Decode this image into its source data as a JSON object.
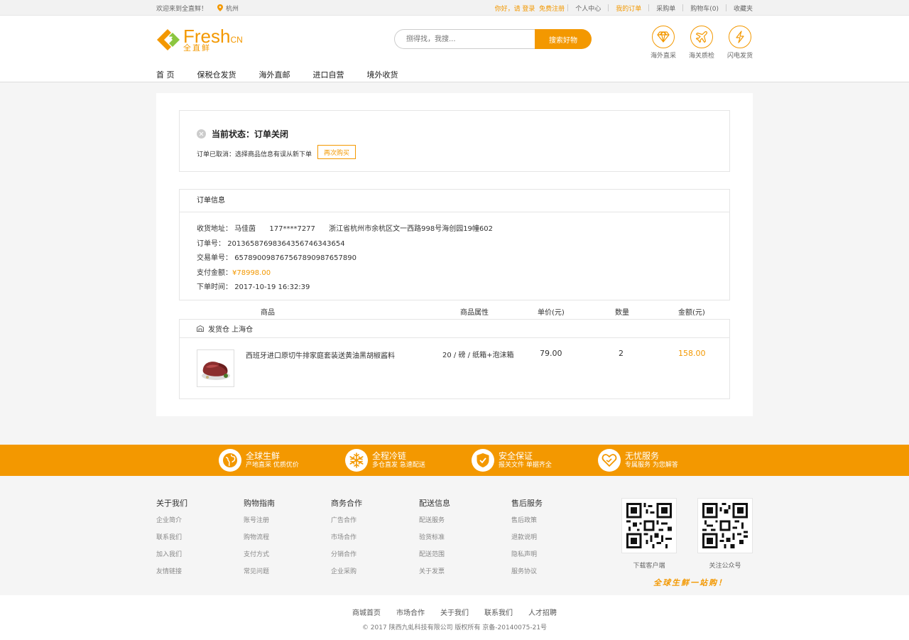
{
  "topbar": {
    "welcome": "欢迎来到全直鲜！",
    "city": "杭州",
    "greeting": "你好，请 登录",
    "register": "免费注册",
    "links": [
      "个人中心",
      "我的订单",
      "采购单",
      "购物车(0)",
      "收藏夹"
    ]
  },
  "header": {
    "logo_en": "Fresh",
    "logo_cn_suffix": "CN",
    "logo_cn": "全直鲜",
    "search_placeholder": "捌得找，我搜...",
    "search_button": "搜索好物",
    "services": [
      "海外直采",
      "海关质检",
      "闪电发货"
    ]
  },
  "nav": [
    "首 页",
    "保税仓发货",
    "海外直邮",
    "进口自营",
    "境外收货"
  ],
  "status": {
    "title": "当前状态：订单关闭",
    "desc": "订单已取消：选择商品信息有误从新下单",
    "rebuy": "再次购买"
  },
  "order_info": {
    "heading": "订单信息",
    "address_label": "收货地址：",
    "name": "马佳茵",
    "phone": "177****7277",
    "address": "浙江省杭州市余杭区文一西路998号海创园19幢602",
    "order_no_label": "订单号：",
    "order_no": "20136587698364356746343654",
    "trade_no_label": "交易单号：",
    "trade_no": "6578900987675678909876578​90",
    "pay_label": "支付金额：",
    "pay_amount": "¥78998.00",
    "time_label": "下单时间：",
    "time": "2017-10-19  16:32:39"
  },
  "table": {
    "headers": [
      "商品",
      "商品属性",
      "单价(元)",
      "数量",
      "金额(元)"
    ],
    "warehouse": "发货仓 上海仓",
    "items": [
      {
        "name": "西班牙进口原切牛排家庭套装送黄油黑胡椒酱料",
        "attr": "20 / 磅 / 纸箱+泡沫箱",
        "price": "79.00",
        "qty": "2",
        "total": "158.00"
      }
    ]
  },
  "band": [
    {
      "title": "全球生鲜",
      "sub": "产地直采  优质优价",
      "icon": "globe-icon"
    },
    {
      "title": "全程冷链",
      "sub": "多仓直发  急速配送",
      "icon": "snowflake-icon"
    },
    {
      "title": "安全保证",
      "sub": "报关文件  单据齐全",
      "icon": "shield-icon"
    },
    {
      "title": "无忧服务",
      "sub": "专属服务  为您解答",
      "icon": "heart-hand-icon"
    }
  ],
  "footer_cols": [
    {
      "title": "关于我们",
      "links": [
        "企业简介",
        "联系我们",
        "加入我们",
        "友情链接"
      ]
    },
    {
      "title": "购物指南",
      "links": [
        "账号注册",
        "购物流程",
        "支付方式",
        "常见问题"
      ]
    },
    {
      "title": "商务合作",
      "links": [
        "广告合作",
        "市场合作",
        "分销合作",
        "企业采购"
      ]
    },
    {
      "title": "配送信息",
      "links": [
        "配送服务",
        "验货标准",
        "配送范围",
        "关于发票"
      ]
    },
    {
      "title": "售后服务",
      "links": [
        "售后政策",
        "退款说明",
        "隐私声明",
        "服务协议"
      ]
    }
  ],
  "qr": [
    "下载客户端",
    "关注公众号"
  ],
  "slogan": "全球生鲜一站购！",
  "bottom_links": [
    "商城首页",
    "市场合作",
    "关于我们",
    "联系我们",
    "人才招聘"
  ],
  "copyright": "©  2017 陕西九虬科技有限公司    版权所有  京备-20140075-21号",
  "colors": {
    "accent": "#f39800",
    "logo_green": "#8cc63f"
  }
}
